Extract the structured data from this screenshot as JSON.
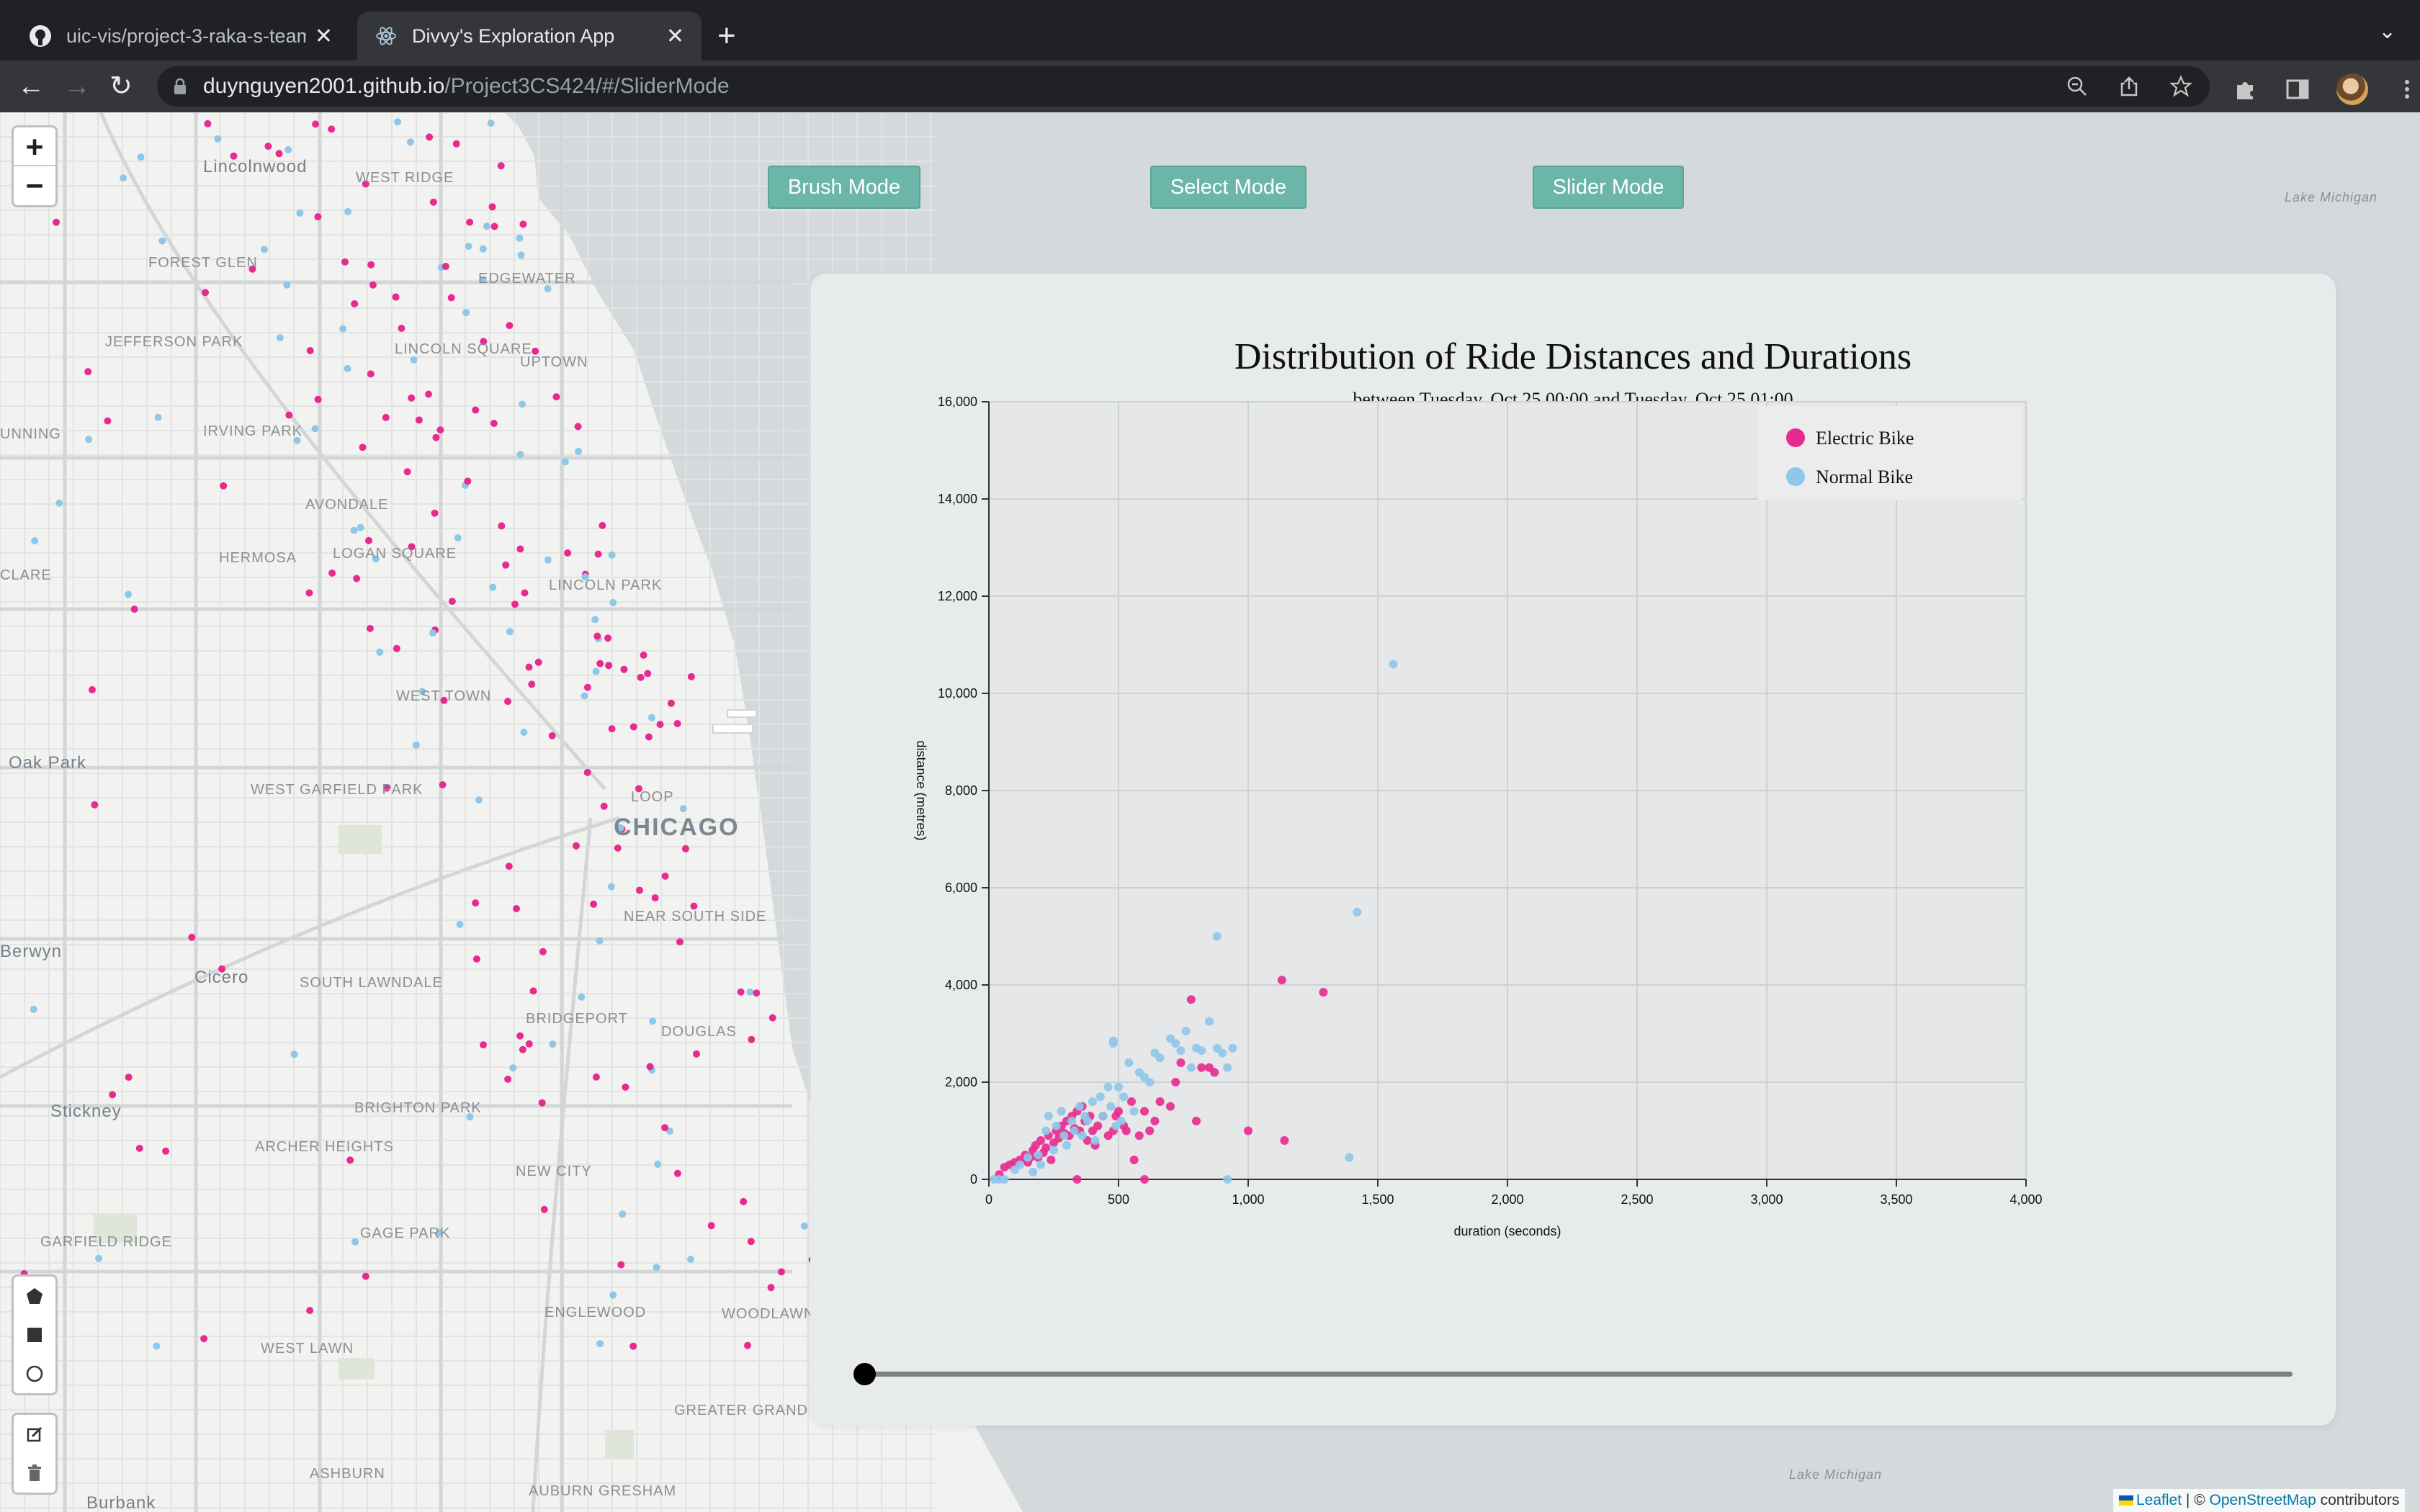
{
  "browser": {
    "tabs": [
      {
        "title": "uic-vis/project-3-raka-s-team",
        "active": false
      },
      {
        "title": "Divvy's Exploration App",
        "active": true
      }
    ],
    "url_host": "duynguyen2001.github.io",
    "url_path": "/Project3CS424/#/SliderMode"
  },
  "map": {
    "zoom_in": "+",
    "zoom_out": "−",
    "places": [
      "Lincolnwood",
      "WEST RIDGE",
      "FOREST GLEN",
      "EDGEWATER",
      "JEFFERSON PARK",
      "LINCOLN SQUARE",
      "UPTOWN",
      "IRVING PARK",
      "UNNING",
      "AVONDALE",
      "HERMOSA",
      "LOGAN SQUARE",
      "LINCOLN PARK",
      "CLARE",
      "WEST TOWN",
      "Oak Park",
      "WEST GARFIELD PARK",
      "LOOP",
      "CHICAGO",
      "NEAR SOUTH SIDE",
      "Berwyn",
      "Cicero",
      "SOUTH LAWNDALE",
      "BRIDGEPORT",
      "DOUGLAS",
      "Stickney",
      "BRIGHTON PARK",
      "ARCHER HEIGHTS",
      "NEW CITY",
      "GARFIELD RIDGE",
      "GAGE PARK",
      "ENGLEWOOD",
      "WOODLAWN",
      "WEST LAWN",
      "GREATER GRAND CROSSING",
      "ASHBURN",
      "AUBURN GRESHAM",
      "Burbank",
      "Lake Michigan",
      "Lake Michigan"
    ],
    "attribution": {
      "leaflet": "Leaflet",
      "sep": " | © ",
      "osm": "OpenStreetMap",
      "suffix": " contributors"
    }
  },
  "modes": {
    "brush": "Brush Mode",
    "select": "Select Mode",
    "slider": "Slider Mode"
  },
  "chart_data": {
    "type": "scatter",
    "title": "Distribution of Ride Distances and Durations",
    "subtitle": "between Tuesday, Oct 25 00:00 and Tuesday, Oct 25 01:00",
    "xlabel": "duration (seconds)",
    "ylabel": "distance (metres)",
    "xlim": [
      0,
      4000
    ],
    "ylim": [
      0,
      16000
    ],
    "xticks": [
      "0",
      "500",
      "1,000",
      "1,500",
      "2,000",
      "2,500",
      "3,000",
      "3,500",
      "4,000"
    ],
    "yticks": [
      "0",
      "2,000",
      "4,000",
      "6,000",
      "8,000",
      "10,000",
      "12,000",
      "14,000",
      "16,000"
    ],
    "grid": true,
    "legend_position": "top-right",
    "series": [
      {
        "name": "Electric Bike",
        "color": "#e8298f",
        "points": [
          [
            40,
            100
          ],
          [
            60,
            250
          ],
          [
            80,
            300
          ],
          [
            100,
            350
          ],
          [
            120,
            400
          ],
          [
            140,
            500
          ],
          [
            150,
            350
          ],
          [
            160,
            450
          ],
          [
            170,
            600
          ],
          [
            180,
            700
          ],
          [
            190,
            450
          ],
          [
            200,
            800
          ],
          [
            210,
            550
          ],
          [
            220,
            650
          ],
          [
            230,
            900
          ],
          [
            240,
            400
          ],
          [
            250,
            750
          ],
          [
            260,
            1000
          ],
          [
            270,
            850
          ],
          [
            280,
            1100
          ],
          [
            290,
            950
          ],
          [
            300,
            1200
          ],
          [
            310,
            900
          ],
          [
            320,
            1300
          ],
          [
            330,
            1050
          ],
          [
            340,
            1400
          ],
          [
            350,
            1000
          ],
          [
            360,
            1500
          ],
          [
            370,
            1200
          ],
          [
            380,
            800
          ],
          [
            390,
            1300
          ],
          [
            400,
            1000
          ],
          [
            410,
            700
          ],
          [
            420,
            1100
          ],
          [
            440,
            1300
          ],
          [
            460,
            900
          ],
          [
            480,
            1000
          ],
          [
            490,
            1300
          ],
          [
            500,
            1400
          ],
          [
            520,
            1100
          ],
          [
            530,
            1000
          ],
          [
            550,
            1600
          ],
          [
            560,
            400
          ],
          [
            580,
            900
          ],
          [
            600,
            1400
          ],
          [
            620,
            1000
          ],
          [
            640,
            1200
          ],
          [
            660,
            1600
          ],
          [
            700,
            1500
          ],
          [
            720,
            2000
          ],
          [
            740,
            2400
          ],
          [
            780,
            3700
          ],
          [
            800,
            1200
          ],
          [
            820,
            2300
          ],
          [
            850,
            2300
          ],
          [
            870,
            2200
          ],
          [
            1000,
            1000
          ],
          [
            1130,
            4100
          ],
          [
            1140,
            800
          ],
          [
            1290,
            3850
          ],
          [
            600,
            0
          ],
          [
            340,
            0
          ]
        ]
      },
      {
        "name": "Normal Bike",
        "color": "#8ec7ea",
        "points": [
          [
            20,
            0
          ],
          [
            40,
            0
          ],
          [
            60,
            0
          ],
          [
            100,
            200
          ],
          [
            120,
            300
          ],
          [
            150,
            450
          ],
          [
            170,
            150
          ],
          [
            190,
            500
          ],
          [
            200,
            300
          ],
          [
            220,
            1000
          ],
          [
            230,
            1300
          ],
          [
            250,
            600
          ],
          [
            260,
            1100
          ],
          [
            280,
            1400
          ],
          [
            290,
            900
          ],
          [
            300,
            700
          ],
          [
            320,
            1200
          ],
          [
            330,
            1000
          ],
          [
            350,
            1500
          ],
          [
            360,
            900
          ],
          [
            370,
            1300
          ],
          [
            380,
            1200
          ],
          [
            400,
            1600
          ],
          [
            410,
            800
          ],
          [
            430,
            1700
          ],
          [
            440,
            1300
          ],
          [
            460,
            1900
          ],
          [
            470,
            1500
          ],
          [
            480,
            2800
          ],
          [
            490,
            1100
          ],
          [
            500,
            1900
          ],
          [
            510,
            1200
          ],
          [
            520,
            1700
          ],
          [
            540,
            2400
          ],
          [
            560,
            1400
          ],
          [
            580,
            2200
          ],
          [
            600,
            2100
          ],
          [
            620,
            2000
          ],
          [
            640,
            2600
          ],
          [
            660,
            2500
          ],
          [
            700,
            2900
          ],
          [
            720,
            2800
          ],
          [
            740,
            2650
          ],
          [
            760,
            3050
          ],
          [
            780,
            2300
          ],
          [
            800,
            2700
          ],
          [
            820,
            2650
          ],
          [
            850,
            3250
          ],
          [
            880,
            2700
          ],
          [
            900,
            2600
          ],
          [
            920,
            2300
          ],
          [
            940,
            2700
          ],
          [
            880,
            5000
          ],
          [
            920,
            0
          ],
          [
            1390,
            450
          ],
          [
            1420,
            5500
          ],
          [
            1560,
            10600
          ],
          [
            480,
            2850
          ]
        ]
      }
    ]
  },
  "slider": {
    "value": 0
  }
}
